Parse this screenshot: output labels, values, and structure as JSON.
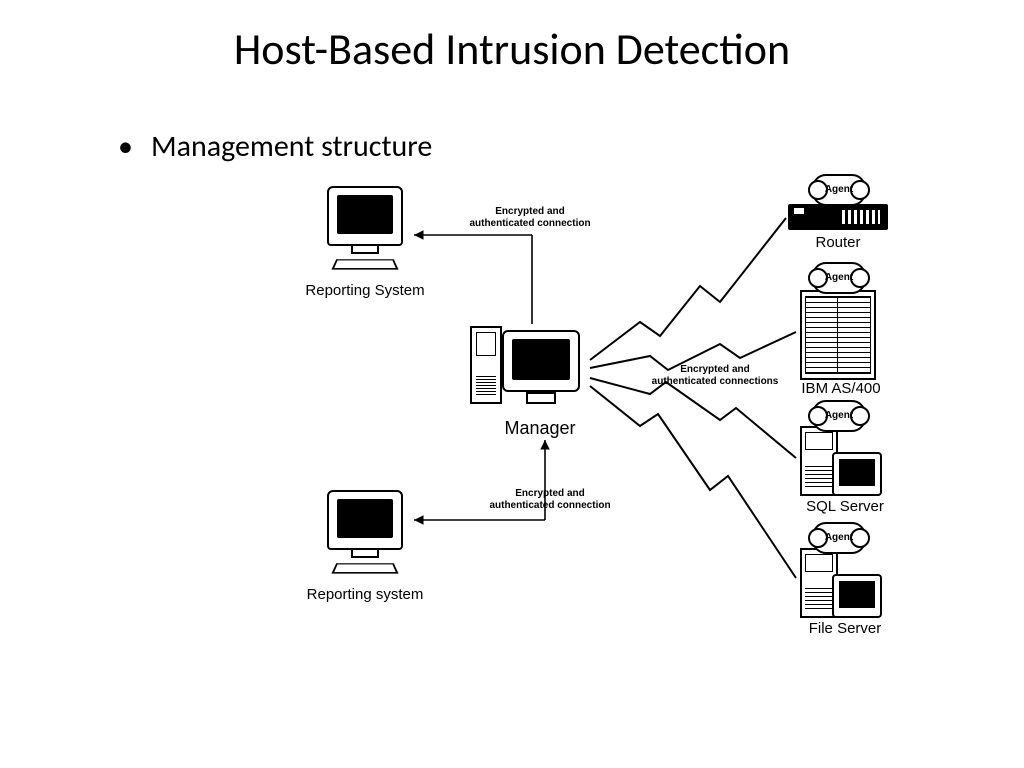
{
  "title": "Host-Based Intrusion Detection",
  "bullet": "Management structure",
  "nodes": {
    "reporting_top": "Reporting System",
    "reporting_bottom": "Reporting system",
    "manager": "Manager",
    "router": "Router",
    "as400": "IBM AS/400",
    "sql": "SQL Server",
    "file": "File Server"
  },
  "agent_label": "Agent",
  "edge_single": "Encrypted and\nauthenticated connection",
  "edge_plural": "Encrypted and\nauthenticated connections"
}
